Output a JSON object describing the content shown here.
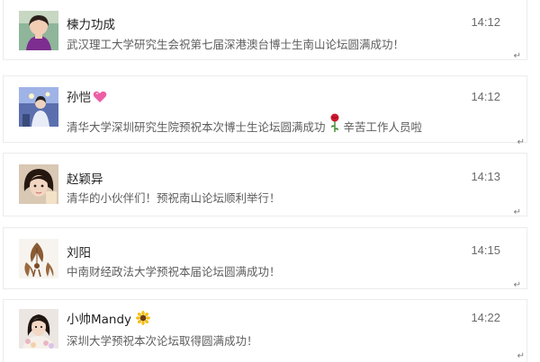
{
  "messages": [
    {
      "name": "楝力功成",
      "text": "武汉理工大学研究生会祝第七届深港澳台博士生南山论坛圆满成功！",
      "time": "14:12",
      "avatar_icon": "girl-purple-avatar"
    },
    {
      "name": "孙恺",
      "name_emoji": "pink-heart-icon",
      "text": "清华大学深圳研究生院预祝本次博士生论坛圆满成功",
      "text_emoji": "rose-icon",
      "text_after": "辛苦工作人员啦",
      "time": "14:12",
      "avatar_icon": "stage-performer-avatar"
    },
    {
      "name": "赵颖异",
      "text": "清华的小伙伴们！预祝南山论坛顺利举行！",
      "time": "14:13",
      "avatar_icon": "girl-selfie-avatar"
    },
    {
      "name": "刘阳",
      "text": "中南财经政法大学预祝本届论坛圆满成功！",
      "time": "14:15",
      "avatar_icon": "leaf-figures-avatar"
    },
    {
      "name": "小帅Mandy",
      "name_emoji": "sunflower-icon",
      "text": "深圳大学预祝本次论坛取得圆满成功！",
      "time": "14:22",
      "avatar_icon": "girl-flowers-avatar"
    }
  ],
  "return_glyph": "↵",
  "colors": {
    "name": "#222222",
    "text": "#5d5d5d",
    "time": "#6b6b6b",
    "border": "#ececec"
  }
}
